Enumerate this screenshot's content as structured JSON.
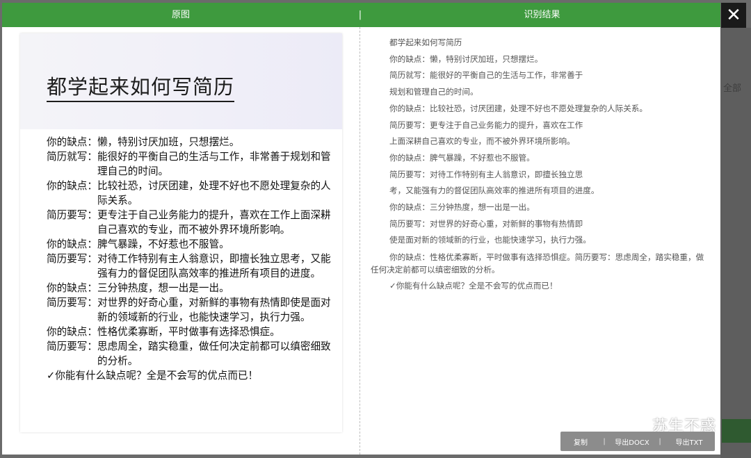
{
  "header": {
    "left_title": "原图",
    "separator": "|",
    "right_title": "识别结果"
  },
  "close_label": "✕",
  "original": {
    "title": "都学起来如何写简历",
    "lines": [
      {
        "label": "你的缺点：",
        "text": "懒，特别讨厌加班，只想摆烂。"
      },
      {
        "label": "简历就写：",
        "text": "能很好的平衡自己的生活与工作，非常善于规划和管理自己的时间。"
      },
      {
        "label": "你的缺点：",
        "text": "比较社恐，讨厌团建，处理不好也不愿处理复杂的人际关系。"
      },
      {
        "label": "简历要写：",
        "text": "更专注于自己业务能力的提升，喜欢在工作上面深耕自己喜欢的专业，而不被外界环境所影响。"
      },
      {
        "label": "你的缺点：",
        "text": "脾气暴躁，不好惹也不服管。"
      },
      {
        "label": "简历要写：",
        "text": "对待工作特别有主人翁意识，即擅长独立思考，又能强有力的督促团队高效率的推进所有项目的进度。"
      },
      {
        "label": "你的缺点：",
        "text": "三分钟热度，想一出是一出。"
      },
      {
        "label": "简历要写：",
        "text": "对世界的好奇心重，对新鲜的事物有热情即使是面对新的领域新的行业，也能快速学习，执行力强。"
      },
      {
        "label": "你的缺点：",
        "text": "性格优柔寡断，平时做事有选择恐惧症。"
      },
      {
        "label": "简历要写：",
        "text": "思虑周全，踏实稳重，做任何决定前都可以缜密细致的分析。"
      }
    ],
    "closing": "✓你能有什么缺点呢？全是不会写的优点而已！"
  },
  "result": {
    "lines": [
      "都学起来如何写简历",
      "你的缺点：懒，特别讨厌加班，只想摆烂。",
      "简历就写：能很好的平衡自己的生活与工作，非常善于",
      "规划和管理自己的时间。",
      "你的缺点：比较社恐，讨厌团建，处理不好也不愿处理复杂的人际关系。",
      "简历要写：更专注于自己业务能力的提升，喜欢在工作",
      "上面深耕自己喜欢的专业，而不被外界环境所影响。",
      "你的缺点：脾气暴躁，不好惹也不服管。",
      "简历要写：对待工作特别有主人翁意识，即擅长独立思",
      "考，又能强有力的督促团队高效率的推进所有项目的进度。",
      "你的缺点：三分钟热度，想一出是一出。",
      "简历要写：对世界的好奇心重，对新鲜的事物有热情即",
      "使是面对新的领域新的行业，也能快速学习，执行力强。"
    ],
    "wrapped": "你的缺点：性格优柔寡断，平时做事有选择恐惧症。简历要写：思虑周全，踏实稳重，做任何决定前都可以缜密细致的分析。",
    "closing": "✓你能有什么缺点呢？全是不会写的优点而已！"
  },
  "toolbar": {
    "copy": "复制",
    "export_docx": "导出DOCX",
    "export_txt": "导出TXT",
    "separator": "|"
  },
  "watermark": "苏生不惑",
  "backdrop_tag": "全部",
  "icons": {
    "close": "close-icon",
    "watermark": "wechat-icon"
  },
  "colors": {
    "header_green": "#3e9a3e",
    "overlay": "#6f6f6f",
    "toolbar": "#8c8c8c"
  }
}
